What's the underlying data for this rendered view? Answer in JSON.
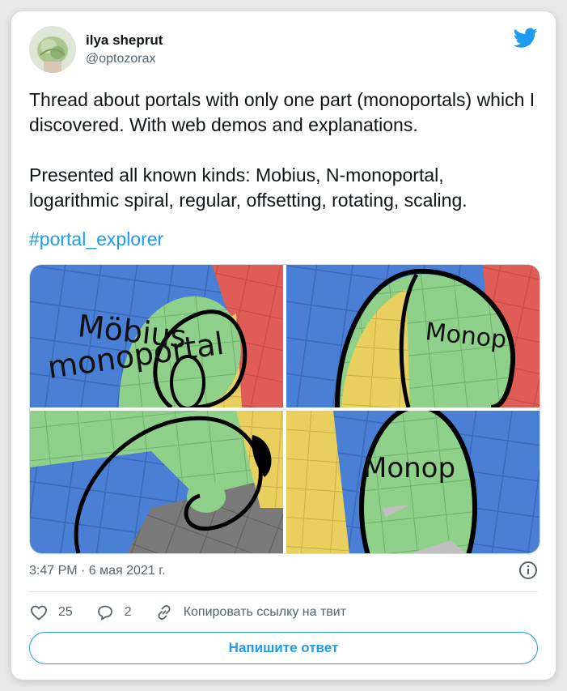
{
  "author": {
    "name": "ilya sheprut",
    "handle": "@optozorax"
  },
  "tweet": {
    "text": "Thread about portals with only one part (monoportals) which I discovered. With web demos and explanations.\n\nPresented all known kinds: Mobius, N-monoportal, logarithmic spiral, regular, offsetting, rotating, scaling.",
    "hashtag": "#portal_explorer"
  },
  "media": {
    "panel1": {
      "line1": "Möbius",
      "line2": "monoportal"
    },
    "panel2": {
      "label": "Monop"
    },
    "panel4": {
      "label": "Monop"
    }
  },
  "meta": {
    "timestamp": "3:47 PM · 6 мая 2021 г."
  },
  "actions": {
    "likes": "25",
    "replies": "2",
    "copy_link": "Копировать ссылку на твит"
  },
  "reply_button": "Напишите ответ",
  "colors": {
    "accent": "#1d9bf0",
    "muted": "#536471",
    "text": "#0f1419"
  },
  "icons": [
    "twitter-bird-icon",
    "info-icon",
    "heart-icon",
    "reply-icon",
    "link-icon"
  ]
}
